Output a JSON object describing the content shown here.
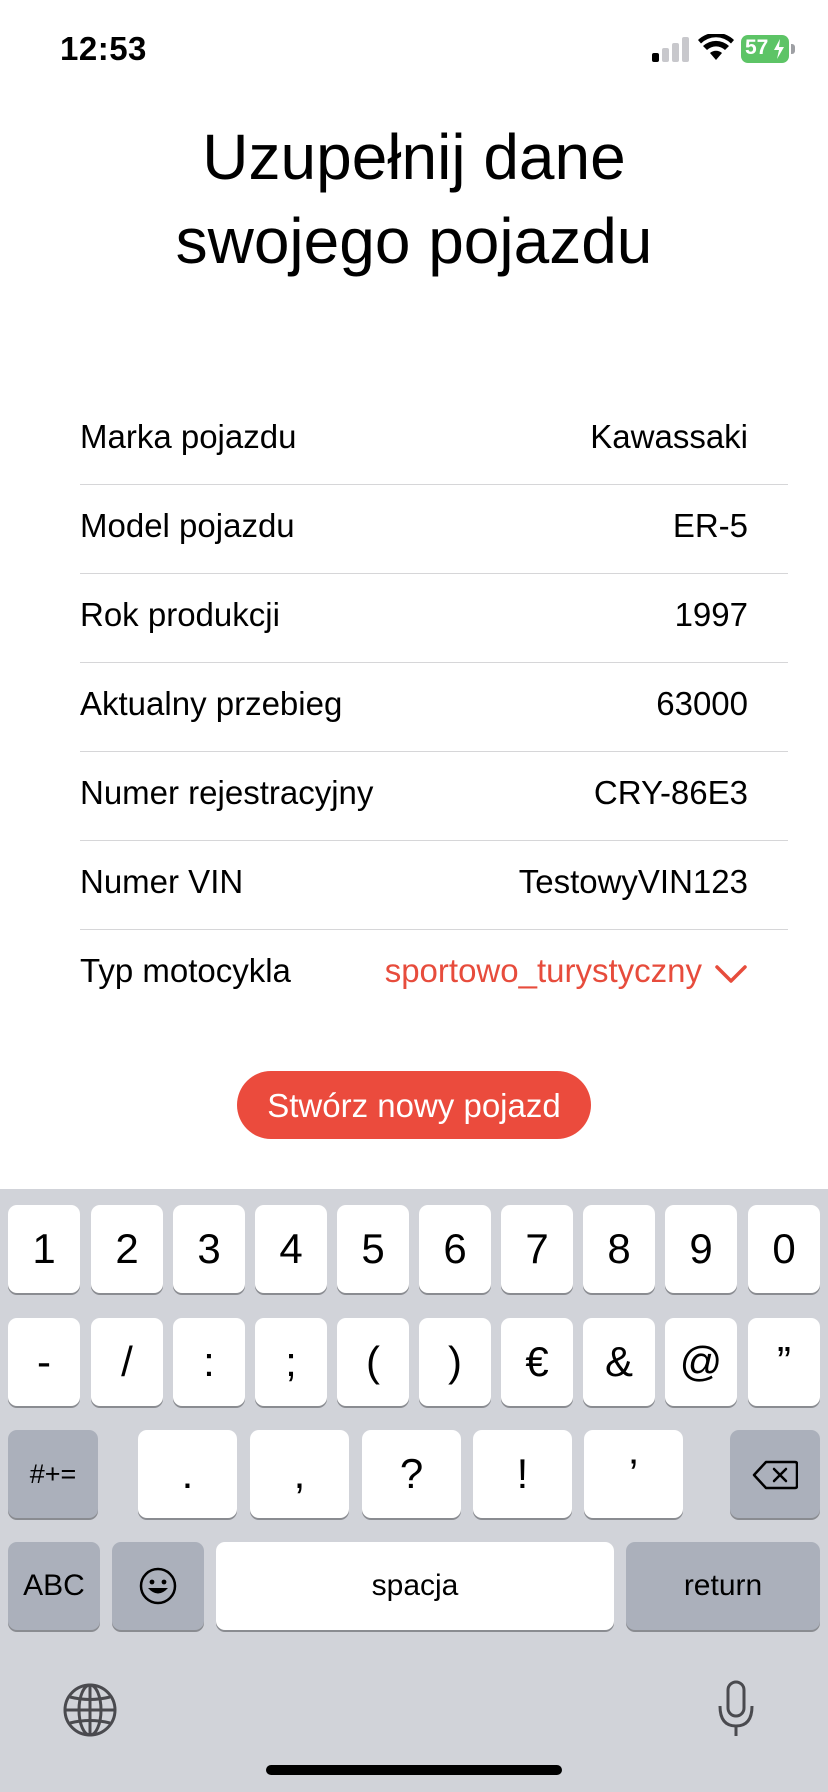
{
  "status_bar": {
    "time": "12:53",
    "battery": "57"
  },
  "title": {
    "line1": "Uzupełnij dane",
    "line2": "swojego pojazdu"
  },
  "form": {
    "rows": [
      {
        "label": "Marka pojazdu",
        "value": "Kawassaki"
      },
      {
        "label": "Model pojazdu",
        "value": "ER-5"
      },
      {
        "label": "Rok produkcji",
        "value": "1997"
      },
      {
        "label": "Aktualny przebieg",
        "value": "63000"
      },
      {
        "label": "Numer rejestracyjny",
        "value": "CRY-86E3"
      },
      {
        "label": "Numer VIN",
        "value": "TestowyVIN123"
      }
    ],
    "type_label": "Typ motocykla",
    "type_value": "sportowo_turystyczny"
  },
  "create_button": {
    "label": "Stwórz nowy pojazd"
  },
  "accent_color": "#eb4b3d",
  "keyboard": {
    "row1": [
      "1",
      "2",
      "3",
      "4",
      "5",
      "6",
      "7",
      "8",
      "9",
      "0"
    ],
    "row2": [
      "-",
      "/",
      ":",
      ";",
      "(",
      ")",
      "€",
      "&",
      "@",
      "”"
    ],
    "row3": [
      ".",
      ",",
      "?",
      "!",
      "’"
    ],
    "symbols_key": "#+=",
    "abc_key": "ABC",
    "space_key": "spacja",
    "return_key": "return",
    "emoji_icon": "emoji-icon",
    "delete_icon": "backspace-icon",
    "globe_icon": "globe-icon",
    "mic_icon": "microphone-icon"
  }
}
